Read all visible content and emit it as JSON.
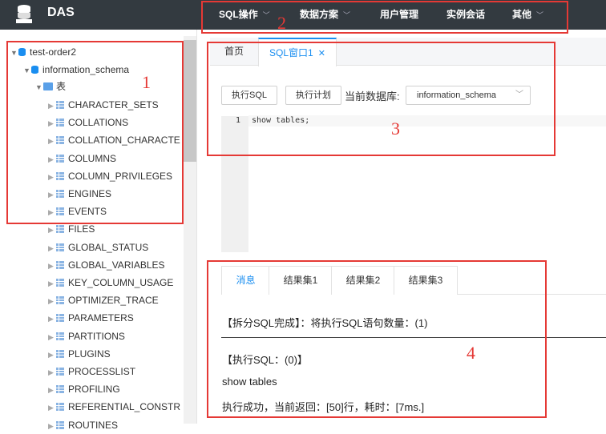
{
  "app": {
    "brand": "DAS",
    "logo_icon": "database-stack-icon"
  },
  "menu": [
    {
      "label": "SQL操作",
      "dropdown": true
    },
    {
      "label": "数据方案",
      "dropdown": true
    },
    {
      "label": "用户管理",
      "dropdown": false
    },
    {
      "label": "实例会话",
      "dropdown": false
    },
    {
      "label": "其他",
      "dropdown": true
    }
  ],
  "tree": {
    "instance": "test-order2",
    "schema": "information_schema",
    "group": "表",
    "tables": [
      "CHARACTER_SETS",
      "COLLATIONS",
      "COLLATION_CHARACTE",
      "COLUMNS",
      "COLUMN_PRIVILEGES",
      "ENGINES",
      "EVENTS",
      "FILES",
      "GLOBAL_STATUS",
      "GLOBAL_VARIABLES",
      "KEY_COLUMN_USAGE",
      "OPTIMIZER_TRACE",
      "PARAMETERS",
      "PARTITIONS",
      "PLUGINS",
      "PROCESSLIST",
      "PROFILING",
      "REFERENTIAL_CONSTR",
      "ROUTINES"
    ]
  },
  "tabs": {
    "home": "首页",
    "sql_window": "SQL窗口1",
    "close": "✕"
  },
  "toolbar": {
    "execute_sql": "执行SQL",
    "execute_plan": "执行计划",
    "current_db_label": "当前数据库:",
    "current_db_value": "information_schema"
  },
  "editor": {
    "line_number": "1",
    "code": "show tables;"
  },
  "results": {
    "tabs": [
      "消息",
      "结果集1",
      "结果集2",
      "结果集3"
    ],
    "messages": {
      "split_done": "【拆分SQL完成】：将执行SQL语句数量：(1)",
      "exec_header": "【执行SQL：(0)】",
      "statement": "show tables",
      "exec_result": "执行成功，当前返回：[50]行，耗时：[7ms.]"
    }
  },
  "annotations": [
    "1",
    "2",
    "3",
    "4"
  ],
  "colors": {
    "topbar": "#333a40",
    "accent": "#1a8ef0",
    "annotation": "#e53935"
  }
}
